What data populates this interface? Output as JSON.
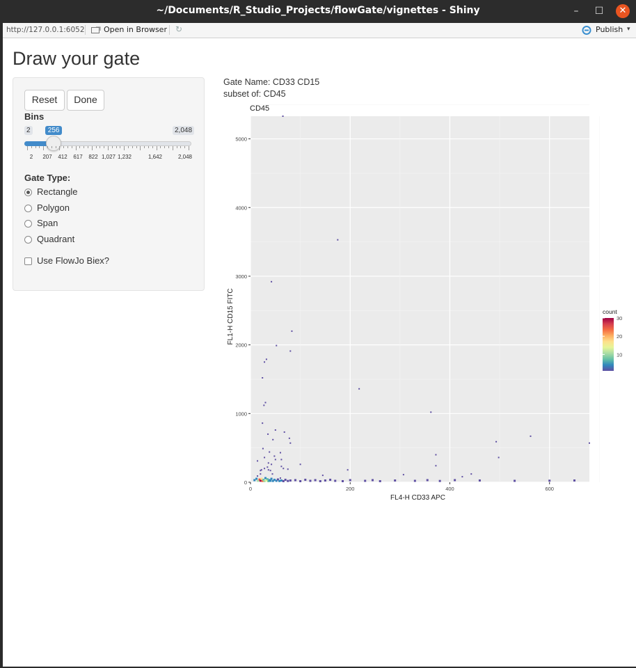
{
  "window": {
    "title": "~/Documents/R_Studio_Projects/flowGate/vignettes - Shiny",
    "minimize": "–",
    "maximize": "☐",
    "close": "✕"
  },
  "toolbar": {
    "url": "http://127.0.0.1:6052",
    "open_browser": "Open in Browser",
    "publish": "Publish"
  },
  "page": {
    "title": "Draw your gate"
  },
  "controls": {
    "reset": "Reset",
    "done": "Done",
    "bins_label": "Bins",
    "bins_min": "2",
    "bins_max": "2,048",
    "bins_value": 256,
    "bins_value_label": "256",
    "bins_ticks": [
      "2",
      "207",
      "412",
      "617",
      "822",
      "1,027",
      "1,232",
      "1,642",
      "2,048"
    ],
    "gate_type_label": "Gate Type:",
    "gate_types": [
      "Rectangle",
      "Polygon",
      "Span",
      "Quadrant"
    ],
    "gate_type_selected": "Rectangle",
    "biex_label": "Use FlowJo Biex?",
    "biex_checked": false
  },
  "gate_info": {
    "name_line": "Gate Name: CD33 CD15",
    "subset_line": "subset of: CD45"
  },
  "chart_data": {
    "type": "heatmap",
    "title": "CD45",
    "xlabel": "FL4-H CD33 APC",
    "ylabel": "FL1-H CD15 FITC",
    "xlim": [
      0,
      680
    ],
    "ylim": [
      0,
      5330
    ],
    "xticks": [
      0,
      200,
      400,
      600
    ],
    "yticks": [
      0,
      1000,
      2000,
      3000,
      4000,
      5000
    ],
    "legend": {
      "title": "count",
      "ticks": [
        10,
        20,
        30
      ],
      "position": "right",
      "colors": [
        "#5e4fa2",
        "#3288bd",
        "#66c2a5",
        "#abdda4",
        "#e6f598",
        "#fee08b",
        "#fdae61",
        "#f46d43",
        "#d53e4f",
        "#9e0142"
      ]
    },
    "grid": true,
    "points": [
      [
        65,
        5330
      ],
      [
        175,
        3530
      ],
      [
        42,
        2920
      ],
      [
        83,
        2200
      ],
      [
        52,
        1990
      ],
      [
        80,
        1910
      ],
      [
        32,
        1790
      ],
      [
        28,
        1750
      ],
      [
        24,
        1520
      ],
      [
        30,
        1160
      ],
      [
        27,
        1120
      ],
      [
        218,
        1360
      ],
      [
        362,
        1020
      ],
      [
        24,
        860
      ],
      [
        50,
        760
      ],
      [
        68,
        730
      ],
      [
        35,
        700
      ],
      [
        78,
        640
      ],
      [
        45,
        620
      ],
      [
        80,
        570
      ],
      [
        25,
        490
      ],
      [
        38,
        440
      ],
      [
        60,
        430
      ],
      [
        48,
        380
      ],
      [
        28,
        360
      ],
      [
        50,
        330
      ],
      [
        62,
        330
      ],
      [
        14,
        310
      ],
      [
        36,
        280
      ],
      [
        42,
        260
      ],
      [
        100,
        260
      ],
      [
        34,
        220
      ],
      [
        28,
        200
      ],
      [
        22,
        180
      ],
      [
        36,
        180
      ],
      [
        62,
        230
      ],
      [
        20,
        170
      ],
      [
        66,
        200
      ],
      [
        75,
        190
      ],
      [
        40,
        170
      ],
      [
        195,
        180
      ],
      [
        372,
        400
      ],
      [
        372,
        240
      ],
      [
        493,
        590
      ],
      [
        498,
        360
      ],
      [
        562,
        670
      ],
      [
        680,
        570
      ],
      [
        145,
        100
      ],
      [
        307,
        110
      ],
      [
        443,
        120
      ],
      [
        425,
        80
      ],
      [
        20,
        120
      ],
      [
        44,
        120
      ],
      [
        14,
        90
      ],
      [
        60,
        60
      ]
    ],
    "dense_points": [
      [
        8,
        20,
        3
      ],
      [
        12,
        40,
        5
      ],
      [
        15,
        10,
        10
      ],
      [
        18,
        30,
        25
      ],
      [
        20,
        12,
        30
      ],
      [
        22,
        40,
        18
      ],
      [
        24,
        8,
        22
      ],
      [
        26,
        25,
        8
      ],
      [
        28,
        5,
        12
      ],
      [
        30,
        50,
        5
      ],
      [
        32,
        15,
        14
      ],
      [
        34,
        35,
        6
      ],
      [
        36,
        5,
        9
      ],
      [
        38,
        20,
        4
      ],
      [
        40,
        10,
        3
      ],
      [
        42,
        40,
        3
      ],
      [
        45,
        8,
        5
      ],
      [
        48,
        25,
        4
      ],
      [
        52,
        10,
        3
      ],
      [
        55,
        30,
        2
      ],
      [
        58,
        8,
        3
      ],
      [
        62,
        15,
        3
      ],
      [
        66,
        5,
        2
      ],
      [
        70,
        25,
        2
      ],
      [
        75,
        8,
        2
      ],
      [
        80,
        15,
        2
      ],
      [
        90,
        20,
        1
      ],
      [
        100,
        5,
        1
      ],
      [
        110,
        25,
        1
      ],
      [
        120,
        10,
        1
      ],
      [
        130,
        20,
        1
      ],
      [
        140,
        5,
        1
      ],
      [
        150,
        15,
        1
      ],
      [
        160,
        25,
        1
      ],
      [
        170,
        10,
        1
      ],
      [
        185,
        5,
        1
      ],
      [
        200,
        20,
        1
      ],
      [
        230,
        10,
        1
      ],
      [
        245,
        20,
        1
      ],
      [
        260,
        5,
        1
      ],
      [
        290,
        15,
        1
      ],
      [
        330,
        10,
        1
      ],
      [
        355,
        20,
        1
      ],
      [
        380,
        8,
        1
      ],
      [
        410,
        20,
        1
      ],
      [
        460,
        15,
        1
      ],
      [
        530,
        10,
        1
      ],
      [
        600,
        12,
        1
      ],
      [
        650,
        15,
        1
      ]
    ]
  }
}
